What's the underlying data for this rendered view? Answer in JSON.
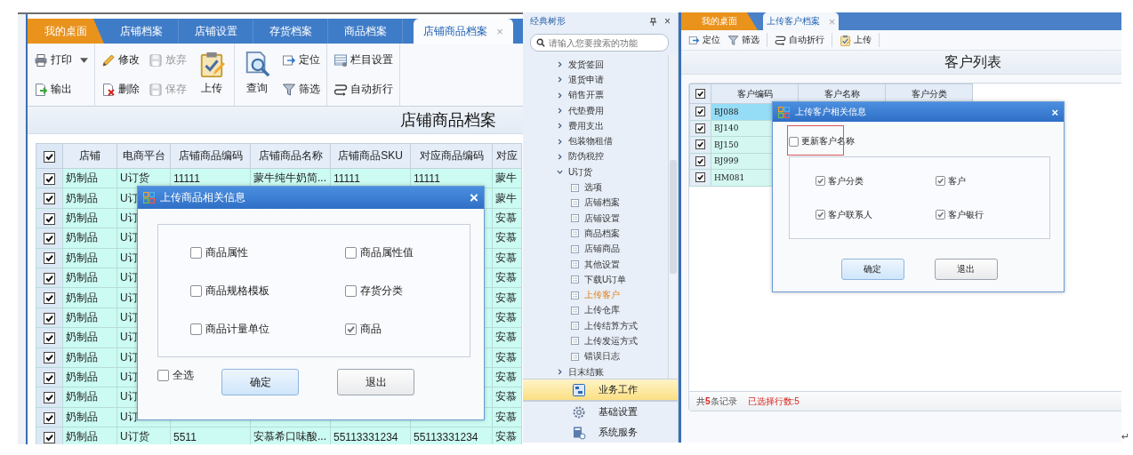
{
  "left_window": {
    "tabs": [
      {
        "label": "我的桌面",
        "kind": "home",
        "selected": false
      },
      {
        "label": "店铺档案",
        "kind": "page",
        "selected": false
      },
      {
        "label": "店铺设置",
        "kind": "page",
        "selected": false
      },
      {
        "label": "存货档案",
        "kind": "page",
        "selected": false
      },
      {
        "label": "商品档案",
        "kind": "page",
        "selected": false
      },
      {
        "label": "店铺商品档案",
        "kind": "page",
        "selected": true,
        "close": "×"
      }
    ],
    "toolbar": [
      [
        [
          {
            "label": "打印",
            "kind": "small",
            "dropdown": true,
            "disabled": false
          },
          {
            "label": "输出",
            "kind": "small",
            "disabled": false
          }
        ]
      ],
      [
        [
          {
            "label": "修改",
            "kind": "small",
            "disabled": false
          },
          {
            "label": "删除",
            "kind": "small",
            "disabled": false
          }
        ],
        [
          {
            "label": "放弃",
            "kind": "small",
            "disabled": true
          },
          {
            "label": "保存",
            "kind": "small",
            "disabled": true
          }
        ],
        [
          {
            "label": "上传",
            "kind": "large",
            "disabled": false
          }
        ]
      ],
      [
        [
          {
            "label": "查询",
            "kind": "large",
            "disabled": false
          }
        ],
        [
          {
            "label": "定位",
            "kind": "small",
            "disabled": false
          },
          {
            "label": "筛选",
            "kind": "small",
            "disabled": false
          }
        ]
      ],
      [
        [
          {
            "label": "栏目设置",
            "kind": "small",
            "disabled": false
          },
          {
            "label": "自动折行",
            "kind": "small",
            "disabled": false
          }
        ]
      ]
    ],
    "title": "店铺商品档案",
    "table": {
      "header_checked": true,
      "columns": [
        "店铺",
        "电商平台",
        "店铺商品编码",
        "店铺商品名称",
        "店铺商品SKU",
        "对应商品编码",
        "对应"
      ],
      "rows": [
        {
          "checked": true,
          "cells": [
            "奶制品",
            "U订货",
            "11111",
            "蒙牛纯牛奶简...",
            "11111",
            "11111",
            "蒙牛"
          ]
        },
        {
          "checked": true,
          "cells": [
            "奶制品",
            "U订",
            null,
            null,
            null,
            null,
            "蒙牛"
          ]
        },
        {
          "checked": true,
          "cells": [
            "奶制品",
            "U订",
            null,
            null,
            null,
            null,
            "安慕"
          ]
        },
        {
          "checked": true,
          "cells": [
            "奶制品",
            "U订",
            null,
            null,
            null,
            null,
            "安慕"
          ]
        },
        {
          "checked": true,
          "cells": [
            "奶制品",
            "U订",
            null,
            null,
            null,
            null,
            "安慕"
          ]
        },
        {
          "checked": true,
          "cells": [
            "奶制品",
            "U订",
            null,
            null,
            null,
            null,
            "安慕"
          ]
        },
        {
          "checked": true,
          "cells": [
            "奶制品",
            "U订",
            null,
            null,
            null,
            null,
            "安慕"
          ]
        },
        {
          "checked": true,
          "cells": [
            "奶制品",
            "U订",
            null,
            null,
            null,
            null,
            "安慕"
          ]
        },
        {
          "checked": true,
          "cells": [
            "奶制品",
            "U订",
            null,
            null,
            null,
            null,
            "安慕"
          ]
        },
        {
          "checked": true,
          "cells": [
            "奶制品",
            "U订",
            null,
            null,
            null,
            null,
            "安慕"
          ]
        },
        {
          "checked": true,
          "cells": [
            "奶制品",
            "U订",
            null,
            null,
            null,
            null,
            "安慕"
          ]
        },
        {
          "checked": true,
          "cells": [
            "奶制品",
            "U订",
            null,
            null,
            null,
            null,
            "安慕"
          ]
        },
        {
          "checked": true,
          "cells": [
            "奶制品",
            "U订",
            null,
            null,
            null,
            null,
            "安慕"
          ]
        },
        {
          "checked": true,
          "cells": [
            "奶制品",
            "U订货",
            "5511",
            "安慕希口味酸...",
            "55113331234",
            "55113331234",
            "安慕"
          ]
        }
      ]
    },
    "dialog": {
      "title": "上传商品相关信息",
      "close": "×",
      "options": [
        {
          "label": "商品属性",
          "checked": false
        },
        {
          "label": "商品属性值",
          "checked": false
        },
        {
          "label": "商品规格模板",
          "checked": false
        },
        {
          "label": "存货分类",
          "checked": false
        },
        {
          "label": "商品计量单位",
          "checked": false
        },
        {
          "label": "商品",
          "checked": true
        }
      ],
      "select_all": {
        "label": "全选",
        "checked": false
      },
      "buttons": [
        {
          "label": "确定",
          "kind": "primary"
        },
        {
          "label": "退出",
          "kind": "secondary"
        }
      ]
    }
  },
  "tree_panel": {
    "title": "经典树形",
    "close": "×",
    "search": {
      "placeholder": "请输入您要搜索的功能"
    },
    "tree": [
      {
        "label": "发货签回",
        "expanded": false,
        "selected": false
      },
      {
        "label": "退货申请",
        "expanded": false,
        "selected": false
      },
      {
        "label": "销售开票",
        "expanded": false,
        "selected": false
      },
      {
        "label": "代垫费用",
        "expanded": false,
        "selected": false
      },
      {
        "label": "费用支出",
        "expanded": false,
        "selected": false
      },
      {
        "label": "包装物租借",
        "expanded": false,
        "selected": false
      },
      {
        "label": "防伪税控",
        "expanded": false,
        "selected": false
      },
      {
        "label": "U订货",
        "expanded": true,
        "selected": false,
        "children": [
          {
            "label": "选项",
            "selected": false
          },
          {
            "label": "店铺档案",
            "selected": false
          },
          {
            "label": "店铺设置",
            "selected": false
          },
          {
            "label": "商品档案",
            "selected": false
          },
          {
            "label": "店铺商品",
            "selected": false
          },
          {
            "label": "其他设置",
            "selected": false
          },
          {
            "label": "下载U订单",
            "selected": false
          },
          {
            "label": "上传客户",
            "selected": true
          },
          {
            "label": "上传仓库",
            "selected": false
          },
          {
            "label": "上传结算方式",
            "selected": false
          },
          {
            "label": "上传发运方式",
            "selected": false
          },
          {
            "label": "错误日志",
            "selected": false
          }
        ]
      },
      {
        "label": "日末结账",
        "expanded": false,
        "selected": false
      }
    ],
    "nav": [
      {
        "label": "业务工作",
        "selected": true
      },
      {
        "label": "基础设置",
        "selected": false
      },
      {
        "label": "系统服务",
        "selected": false
      }
    ]
  },
  "right_window": {
    "tabs": [
      {
        "label": "我的桌面",
        "kind": "home",
        "selected": false
      },
      {
        "label": "上传客户档案",
        "kind": "page",
        "selected": true,
        "close": "×"
      }
    ],
    "toolbar": [
      [
        {
          "label": "定位"
        },
        {
          "label": "筛选"
        }
      ],
      [
        {
          "label": "自动折行"
        }
      ],
      [
        {
          "label": "上传"
        }
      ]
    ],
    "title": "客户列表",
    "table": {
      "header_checked": true,
      "columns": [
        "客户编码",
        "客户名称",
        "客户分类"
      ],
      "rows": [
        {
          "checked": true,
          "selected": true,
          "code": "BJ088"
        },
        {
          "checked": true,
          "selected": false,
          "code": "BJ140"
        },
        {
          "checked": true,
          "selected": false,
          "code": "BJ150"
        },
        {
          "checked": true,
          "selected": false,
          "code": "BJ999"
        },
        {
          "checked": true,
          "selected": false,
          "code": "HM081"
        }
      ]
    },
    "dialog": {
      "title": "上传客户相关信息",
      "close": "×",
      "update_name": {
        "label": "更新客户名称",
        "checked": false,
        "highlighted": true
      },
      "options": [
        {
          "label": "客户分类",
          "checked": true
        },
        {
          "label": "客户",
          "checked": true
        },
        {
          "label": "客户联系人",
          "checked": true
        },
        {
          "label": "客户银行",
          "checked": true
        }
      ],
      "buttons": [
        {
          "label": "确定",
          "kind": "primary"
        },
        {
          "label": "退出",
          "kind": "secondary"
        }
      ]
    },
    "status": {
      "total": "共**5**条记录",
      "selected_count": "已选择行数:5"
    }
  },
  "return_mark": "↵"
}
